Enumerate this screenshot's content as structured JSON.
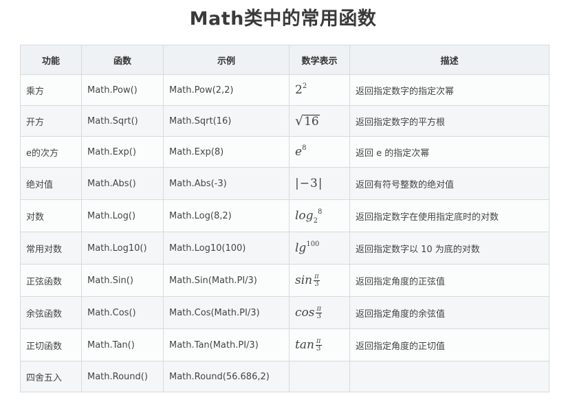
{
  "title": "Math类中的常用函数",
  "headers": {
    "function": "功能",
    "name": "函数",
    "example": "示例",
    "math": "数学表示",
    "description": "描述"
  },
  "rows": [
    {
      "function": "乘方",
      "name": "Math.Pow()",
      "example": "Math.Pow(2,2)",
      "math": {
        "base": "2",
        "sup": "2"
      },
      "description": "返回指定数字的指定次幂"
    },
    {
      "function": "开方",
      "name": "Math.Sqrt()",
      "example": "Math.Sqrt(16)",
      "math": {
        "radicand": "16"
      },
      "description": "返回指定数字的平方根"
    },
    {
      "function": "e的次方",
      "name": "Math.Exp()",
      "example": "Math.Exp(8)",
      "math": {
        "base": "e",
        "sup": "8"
      },
      "description": "返回 e 的指定次幂"
    },
    {
      "function": "绝对值",
      "name": "Math.Abs()",
      "example": "Math.Abs(-3)",
      "math": {
        "text": "|−3|"
      },
      "description": "返回有符号整数的绝对值"
    },
    {
      "function": "对数",
      "name": "Math.Log()",
      "example": "Math.Log(8,2)",
      "math": {
        "base": "log",
        "sub": "2",
        "sup": "8"
      },
      "description": "返回指定数字在使用指定底时的对数"
    },
    {
      "function": "常用对数",
      "name": "Math.Log10()",
      "example": "Math.Log10(100)",
      "math": {
        "base": "lg",
        "sup": "100"
      },
      "description": "返回指定数字以 10 为底的对数"
    },
    {
      "function": "正弦函数",
      "name": "Math.Sin()",
      "example": "Math.Sin(Math.PI/3)",
      "math": {
        "fn": "sin",
        "num": "π",
        "den": "3"
      },
      "description": "返回指定角度的正弦值"
    },
    {
      "function": "余弦函数",
      "name": "Math.Cos()",
      "example": "Math.Cos(Math.PI/3)",
      "math": {
        "fn": "cos",
        "num": "π",
        "den": "3"
      },
      "description": "返回指定角度的余弦值"
    },
    {
      "function": "正切函数",
      "name": "Math.Tan()",
      "example": "Math.Tan(Math.PI/3)",
      "math": {
        "fn": "tan",
        "num": "π",
        "den": "3"
      },
      "description": "返回指定角度的正切值"
    },
    {
      "function": "四舍五入",
      "name": "Math.Round()",
      "example": "Math.Round(56.686,2)",
      "math": {},
      "description": ""
    }
  ]
}
